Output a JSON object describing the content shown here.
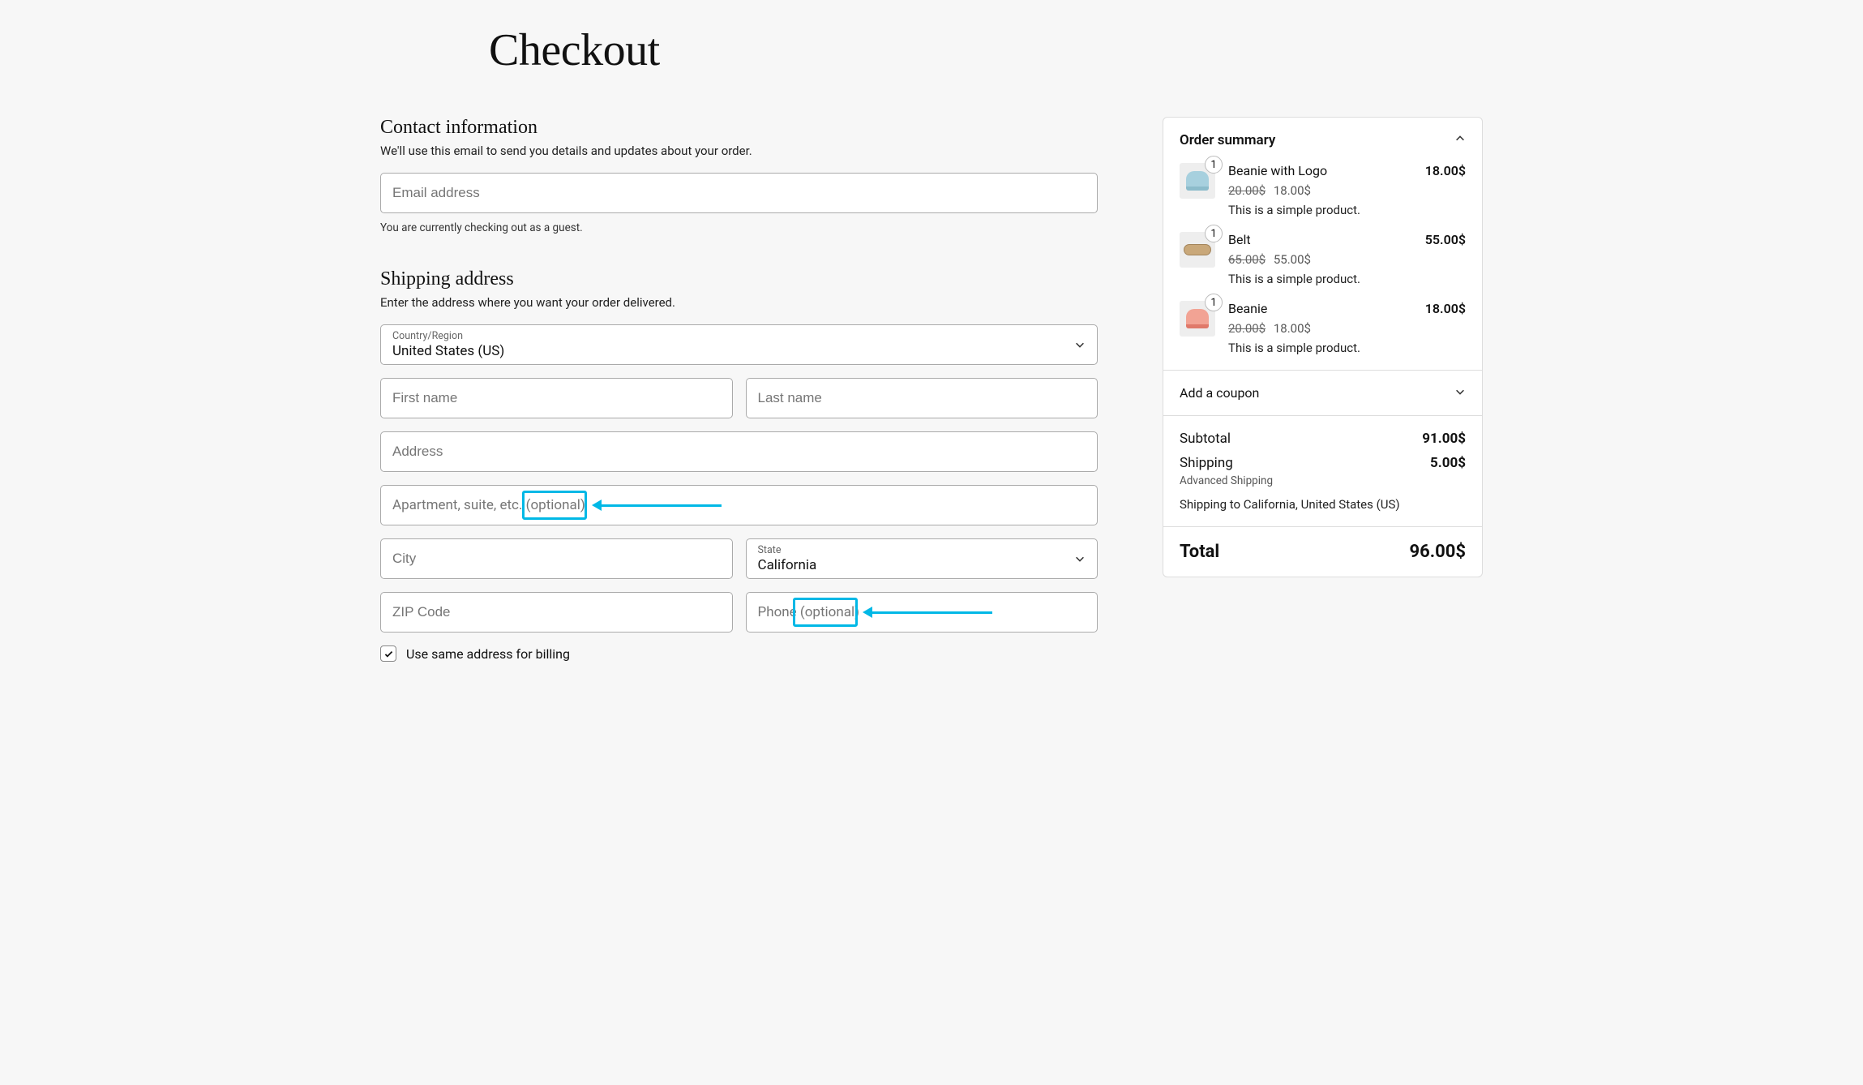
{
  "page": {
    "title": "Checkout"
  },
  "contact": {
    "title": "Contact information",
    "sub": "We'll use this email to send you details and updates about your order.",
    "email_placeholder": "Email address",
    "guest_note": "You are currently checking out as a guest."
  },
  "shipping": {
    "title": "Shipping address",
    "sub": "Enter the address where you want your order delivered.",
    "country_label": "Country/Region",
    "country_value": "United States (US)",
    "first_name_placeholder": "First name",
    "last_name_placeholder": "Last name",
    "address_placeholder": "Address",
    "apt_placeholder_main": "Apartment, suite, etc. ",
    "apt_placeholder_opt": "(optional)",
    "city_placeholder": "City",
    "state_label": "State",
    "state_value": "California",
    "zip_placeholder": "ZIP Code",
    "phone_placeholder_main": "Phone ",
    "phone_placeholder_opt": "(optional)",
    "same_billing_label": "Use same address for billing",
    "same_billing_checked": true
  },
  "order": {
    "title": "Order summary",
    "items": [
      {
        "qty": "1",
        "name": "Beanie with Logo",
        "price": "18.00$",
        "orig": "20.00$",
        "sale": "18.00$",
        "desc": "This is a simple product.",
        "thumb": "beanie-blue"
      },
      {
        "qty": "1",
        "name": "Belt",
        "price": "55.00$",
        "orig": "65.00$",
        "sale": "55.00$",
        "desc": "This is a simple product.",
        "thumb": "belt"
      },
      {
        "qty": "1",
        "name": "Beanie",
        "price": "18.00$",
        "orig": "20.00$",
        "sale": "18.00$",
        "desc": "This is a simple product.",
        "thumb": "beanie-red"
      }
    ],
    "coupon_label": "Add a coupon",
    "subtotal_label": "Subtotal",
    "subtotal_value": "91.00$",
    "shipping_label": "Shipping",
    "shipping_value": "5.00$",
    "shipping_method": "Advanced Shipping",
    "shipping_to": "Shipping to California, United States (US)",
    "total_label": "Total",
    "total_value": "96.00$"
  }
}
